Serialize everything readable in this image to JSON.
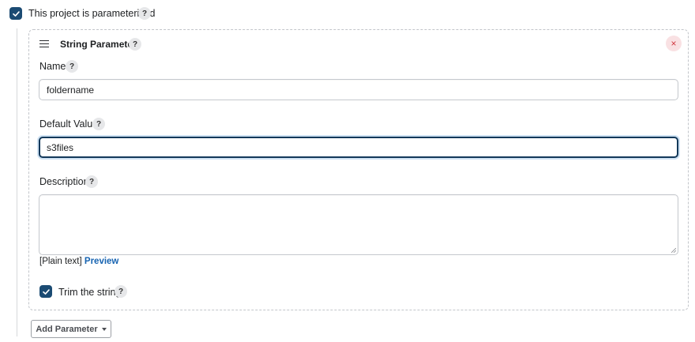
{
  "project_parameterised": {
    "checked": true,
    "label": "This project is parameterised",
    "help": "?"
  },
  "string_parameter": {
    "title": "String Parameter",
    "help": "?",
    "remove_icon": "×",
    "name": {
      "label": "Name",
      "help": "?",
      "value": "foldername"
    },
    "default_value": {
      "label": "Default Value",
      "help": "?",
      "value": "s3files"
    },
    "description": {
      "label": "Description",
      "help": "?",
      "value": "",
      "format_note": "[Plain text]",
      "preview_link": "Preview"
    },
    "trim": {
      "checked": true,
      "label": "Trim the string",
      "help": "?"
    }
  },
  "add_parameter": {
    "label": "Add Parameter"
  },
  "icons": {
    "checkbox": "check-icon",
    "help": "question-mark-icon",
    "drag": "drag-handle-icon",
    "remove": "close-icon",
    "dropdown": "caret-down-icon"
  },
  "colors": {
    "checkbox_bg": "#1b4b73",
    "link": "#1663b1",
    "focus_border": "#13395a",
    "remove_bg": "#f9e1e3",
    "remove_fg": "#d0363f"
  }
}
